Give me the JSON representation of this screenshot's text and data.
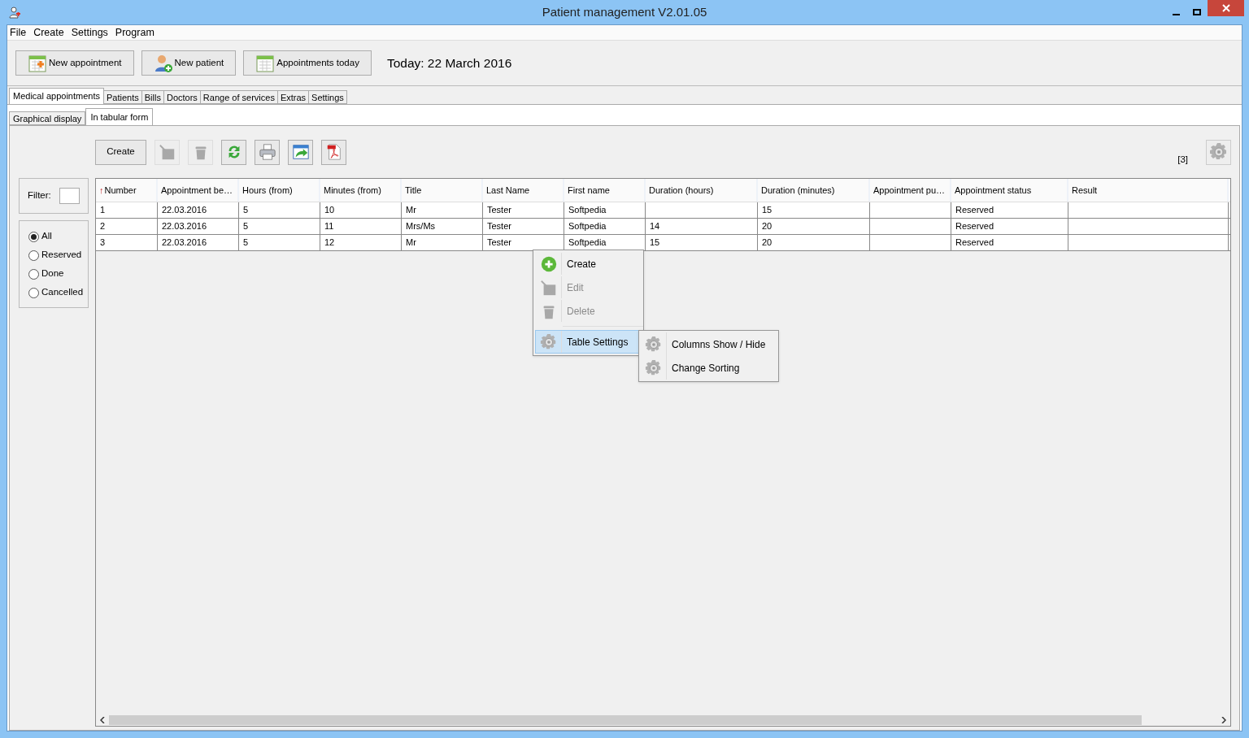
{
  "window": {
    "title": "Patient management V2.01.05"
  },
  "menu_bar": [
    "File",
    "Create",
    "Settings",
    "Program"
  ],
  "toolbar": [
    {
      "label": "New appointment",
      "kind": "calendar-add"
    },
    {
      "label": "New patient",
      "kind": "person-add"
    },
    {
      "label": "Appointments today",
      "kind": "calendar"
    }
  ],
  "today": "Today: 22 March 2016",
  "main_tabs": [
    {
      "label": "Medical appointments",
      "selected": true
    },
    {
      "label": "Patients",
      "selected": false
    },
    {
      "label": "Bills",
      "selected": false
    },
    {
      "label": "Doctors",
      "selected": false
    },
    {
      "label": "Range of services",
      "selected": false
    },
    {
      "label": "Extras",
      "selected": false
    },
    {
      "label": "Settings",
      "selected": false
    }
  ],
  "sub_tabs": [
    {
      "label": "Graphical display",
      "selected": false
    },
    {
      "label": "In tabular form",
      "selected": true
    }
  ],
  "actions": {
    "create_label": "Create",
    "icon_buttons": [
      {
        "kind": "edit",
        "disabled": true
      },
      {
        "kind": "delete",
        "disabled": true
      },
      {
        "kind": "refresh",
        "disabled": false
      },
      {
        "kind": "print",
        "disabled": false
      },
      {
        "kind": "export",
        "disabled": false
      },
      {
        "kind": "pdf",
        "disabled": false
      }
    ],
    "count": "[3]"
  },
  "filter": {
    "label": "Filter:"
  },
  "status_filter": [
    {
      "label": "All",
      "selected": true
    },
    {
      "label": "Reserved",
      "selected": false
    },
    {
      "label": "Done",
      "selected": false
    },
    {
      "label": "Cancelled",
      "selected": false
    }
  ],
  "table": {
    "columns": [
      {
        "label": "Number",
        "sort_mark": "↑"
      },
      {
        "label": "Appointment be…"
      },
      {
        "label": "Hours (from)"
      },
      {
        "label": "Minutes (from)"
      },
      {
        "label": "Title"
      },
      {
        "label": "Last Name"
      },
      {
        "label": "First name"
      },
      {
        "label": "Duration (hours)"
      },
      {
        "label": "Duration (minutes)"
      },
      {
        "label": "Appointment pu…"
      },
      {
        "label": "Appointment status"
      },
      {
        "label": "Result"
      }
    ],
    "rows": [
      [
        "1",
        "22.03.2016",
        "5",
        "10",
        "Mr",
        "Tester",
        "Softpedia",
        "",
        "15",
        "",
        "Reserved",
        ""
      ],
      [
        "2",
        "22.03.2016",
        "5",
        "11",
        "Mrs/Ms",
        "Tester",
        "Softpedia",
        "14",
        "20",
        "",
        "Reserved",
        ""
      ],
      [
        "3",
        "22.03.2016",
        "5",
        "12",
        "Mr",
        "Tester",
        "Softpedia",
        "15",
        "20",
        "",
        "Reserved",
        ""
      ]
    ]
  },
  "context_menu": {
    "items": [
      {
        "label": "Create",
        "kind": "add",
        "disabled": false,
        "selected": false
      },
      {
        "label": "Edit",
        "kind": "edit",
        "disabled": true,
        "selected": false
      },
      {
        "label": "Delete",
        "kind": "delete",
        "disabled": true,
        "selected": false
      },
      {
        "label": "Table Settings",
        "kind": "gear",
        "disabled": false,
        "selected": true
      }
    ],
    "submenu": [
      {
        "label": "Columns Show / Hide",
        "kind": "gear"
      },
      {
        "label": "Change Sorting",
        "kind": "gear"
      }
    ]
  }
}
